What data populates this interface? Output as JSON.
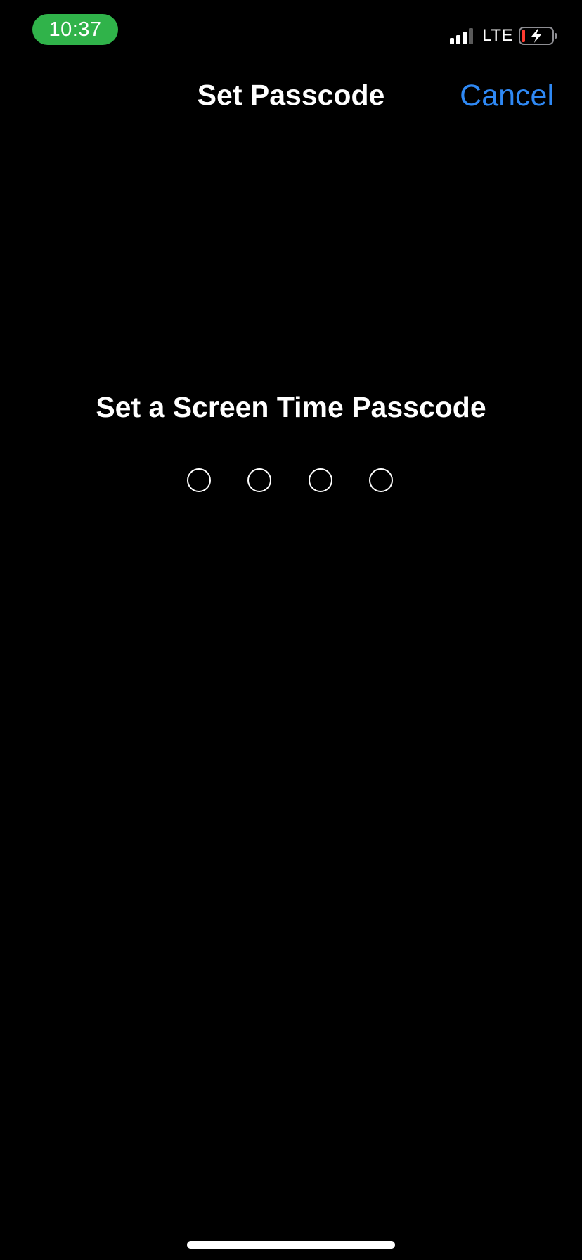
{
  "status_bar": {
    "time": "10:37",
    "time_pill_color": "#30b34a",
    "network": "LTE",
    "signal_bars_active": 3,
    "signal_bars_total": 4,
    "battery_state": "charging-low",
    "battery_level_color": "#ff3b30",
    "icons": [
      "signal-icon",
      "battery-charging-icon"
    ]
  },
  "nav": {
    "title": "Set Passcode",
    "cancel_label": "Cancel",
    "accent_color": "#2f89f5"
  },
  "passcode": {
    "prompt": "Set a Screen Time Passcode",
    "digits_total": 4,
    "digits_entered": 0
  }
}
